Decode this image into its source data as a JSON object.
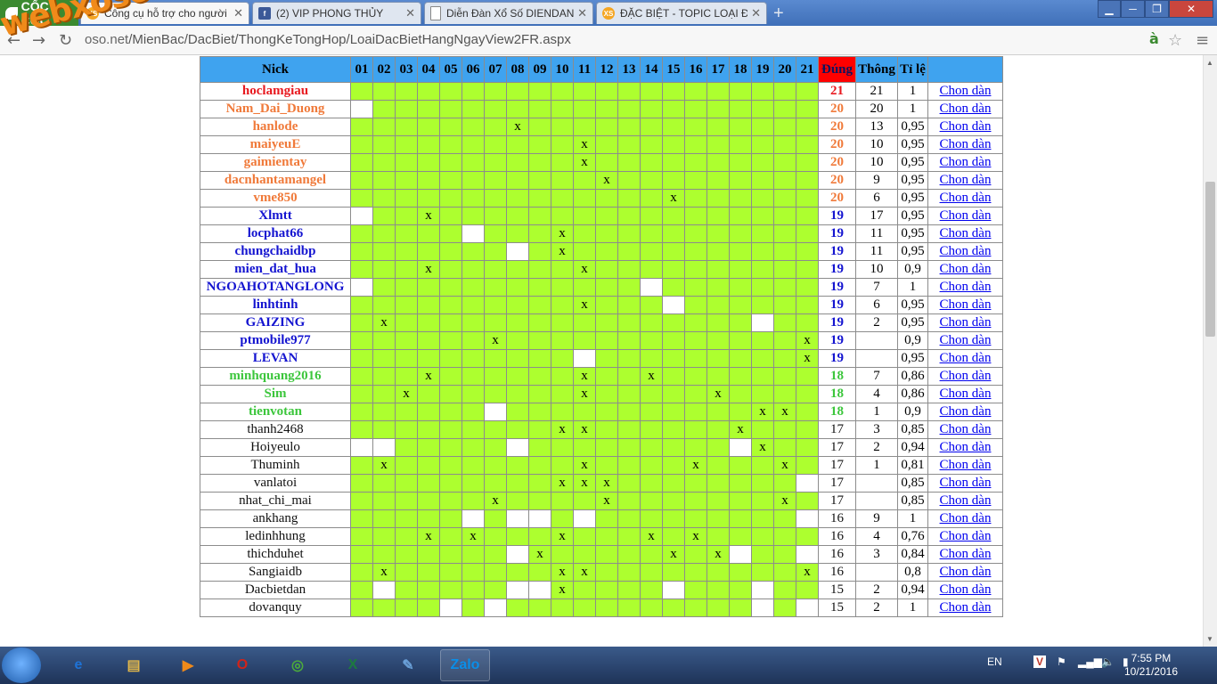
{
  "browser": {
    "logo": "CỐC CỐC",
    "tabs": [
      {
        "title": "Công cụ hỗ trợ cho người",
        "icon": "xs-favicon",
        "active": true
      },
      {
        "title": "(2) VIP PHONG THỦY",
        "icon": "facebook-icon",
        "active": false
      },
      {
        "title": "Diễn Đàn Xổ Số DIENDAN",
        "icon": "page-icon",
        "active": false
      },
      {
        "title": "ĐẶC BIỆT - TOPIC LOẠI ĐẶ",
        "icon": "xs-favicon",
        "active": false
      }
    ],
    "url_prefix": "oso.net",
    "url_path": "/MienBac/DacBiet/ThongKeTongHop/LoaiDacBietHangNgayView2FR.aspx",
    "watermark": "webxoso.net"
  },
  "table": {
    "headers": {
      "nick": "Nick",
      "dung": "Đúng",
      "thong": "Thông",
      "tile": "Tỉ lệ"
    },
    "days": [
      "01",
      "02",
      "03",
      "04",
      "05",
      "06",
      "07",
      "08",
      "09",
      "10",
      "11",
      "12",
      "13",
      "14",
      "15",
      "16",
      "17",
      "18",
      "19",
      "20",
      "21"
    ],
    "link_label": "Chon dàn",
    "rows": [
      {
        "nick": "hoclamgiau",
        "color": "red",
        "cells": "ggggggggggggggggggggg",
        "dung": "21",
        "thong": "21",
        "tile": "1"
      },
      {
        "nick": "Nam_Dai_Duong",
        "color": "orange",
        "cells": "wgggggggggggggggggggg",
        "dung": "20",
        "thong": "20",
        "tile": "1"
      },
      {
        "nick": "hanlode",
        "color": "orange",
        "cells": "gggggggxggggggggggggg",
        "dung": "20",
        "thong": "13",
        "tile": "0,95"
      },
      {
        "nick": "maiyeuE",
        "color": "orange",
        "cells": "ggggggggggxgggggggggg",
        "dung": "20",
        "thong": "10",
        "tile": "0,95"
      },
      {
        "nick": "gaimientay",
        "color": "orange",
        "cells": "ggggggggggxgggggggggg",
        "dung": "20",
        "thong": "10",
        "tile": "0,95"
      },
      {
        "nick": "dacnhantamangel",
        "color": "orange",
        "cells": "gggggggggggxggggggggg",
        "dung": "20",
        "thong": "9",
        "tile": "0,95"
      },
      {
        "nick": "vme850",
        "color": "orange",
        "cells": "ggggggggggggggxgggggg",
        "dung": "20",
        "thong": "6",
        "tile": "0,95"
      },
      {
        "nick": "Xlmtt",
        "color": "blue",
        "cells": "wggxggggggggggggggggg",
        "dung": "19",
        "thong": "17",
        "tile": "0,95"
      },
      {
        "nick": "locphat66",
        "color": "blue",
        "cells": "gggggwgggxggggggggggg",
        "dung": "19",
        "thong": "11",
        "tile": "0,95"
      },
      {
        "nick": "chungchaidbp",
        "color": "blue",
        "cells": "gggggggwgxggggggggggg",
        "dung": "19",
        "thong": "11",
        "tile": "0,95"
      },
      {
        "nick": "mien_dat_hua",
        "color": "blue",
        "cells": "gggxggggggxgggggggggg",
        "dung": "19",
        "thong": "10",
        "tile": "0,9"
      },
      {
        "nick": "NGOAHOTANGLONG",
        "color": "blue",
        "cells": "wggggggggggggwggggggg",
        "dung": "19",
        "thong": "7",
        "tile": "1"
      },
      {
        "nick": "linhtinh",
        "color": "blue",
        "cells": "ggggggggggxgggwgggggg",
        "dung": "19",
        "thong": "6",
        "tile": "0,95"
      },
      {
        "nick": "GAIZING",
        "color": "blue",
        "cells": "gxggggggggggggggggwgg",
        "dung": "19",
        "thong": "2",
        "tile": "0,95"
      },
      {
        "nick": "ptmobile977",
        "color": "blue",
        "cells": "ggggggxgggggggggggggx",
        "dung": "19",
        "thong": "",
        "tile": "0,9"
      },
      {
        "nick": "LEVAN",
        "color": "blue",
        "cells": "ggggggggggwgggggggggx",
        "dung": "19",
        "thong": "",
        "tile": "0,95"
      },
      {
        "nick": "minhquang2016",
        "color": "green",
        "cells": "gggxggggggxggxggggggg",
        "dung": "18",
        "thong": "7",
        "tile": "0,86"
      },
      {
        "nick": "Sim",
        "color": "green",
        "cells": "ggxgggggggxgggggxgggg",
        "dung": "18",
        "thong": "4",
        "tile": "0,86"
      },
      {
        "nick": "tienvotan",
        "color": "green",
        "cells": "ggggggwgggggggggggxxg",
        "dung": "18",
        "thong": "1",
        "tile": "0,9"
      },
      {
        "nick": "thanh2468",
        "color": "normal",
        "cells": "gggggggggxxggggggxggg",
        "dung": "17",
        "thong": "3",
        "tile": "0,85"
      },
      {
        "nick": "Hoiyeulo",
        "color": "normal",
        "cells": "wwgggggwgggggggggwxgg",
        "dung": "17",
        "thong": "2",
        "tile": "0,94"
      },
      {
        "nick": "Thuminh",
        "color": "normal",
        "cells": "gxggggggggxggggxgggxg",
        "dung": "17",
        "thong": "1",
        "tile": "0,81"
      },
      {
        "nick": "vanlatoi",
        "color": "normal",
        "cells": "gggggggggxxxggggggggw",
        "dung": "17",
        "thong": "",
        "tile": "0,85"
      },
      {
        "nick": "nhat_chi_mai",
        "color": "normal",
        "cells": "ggggggxggggxgggggggxgw",
        "dung": "17",
        "thong": "",
        "tile": "0,85"
      },
      {
        "nick": "ankhang",
        "color": "normal",
        "cells": "gggggwgwwgwgggggggggw",
        "dung": "16",
        "thong": "9",
        "tile": "1"
      },
      {
        "nick": "ledinhhung",
        "color": "normal",
        "cells": "gggxgxgggxgggxgxggggg",
        "dung": "16",
        "thong": "4",
        "tile": "0,76"
      },
      {
        "nick": "thichduhet",
        "color": "normal",
        "cells": "gggggggwxgggggxgxwggw",
        "dung": "16",
        "thong": "3",
        "tile": "0,84"
      },
      {
        "nick": "Sangiaidb",
        "color": "normal",
        "cells": "gxgggggggxxgggggggggxw",
        "dung": "16",
        "thong": "",
        "tile": "0,8"
      },
      {
        "nick": "Dacbietdan",
        "color": "normal",
        "cells": "gwgggggwwxggggwgggwgg",
        "dung": "15",
        "thong": "2",
        "tile": "0,94"
      },
      {
        "nick": "dovanquy",
        "color": "normal",
        "cells": "ggggwgwgggggggggggwgw",
        "dung": "15",
        "thong": "2",
        "tile": "1"
      }
    ]
  },
  "taskbar": {
    "apps": [
      {
        "name": "ie-icon",
        "label": "e"
      },
      {
        "name": "explorer-icon",
        "label": "▤"
      },
      {
        "name": "media-icon",
        "label": "▶"
      },
      {
        "name": "opera-icon",
        "label": "O"
      },
      {
        "name": "coccoc-icon",
        "label": "◎"
      },
      {
        "name": "excel-icon",
        "label": "X"
      },
      {
        "name": "paint-icon",
        "label": "✎"
      },
      {
        "name": "zalo-icon",
        "label": "Zalo"
      }
    ],
    "lang": "EN",
    "time": "7:55 PM",
    "date": "10/21/2016"
  }
}
